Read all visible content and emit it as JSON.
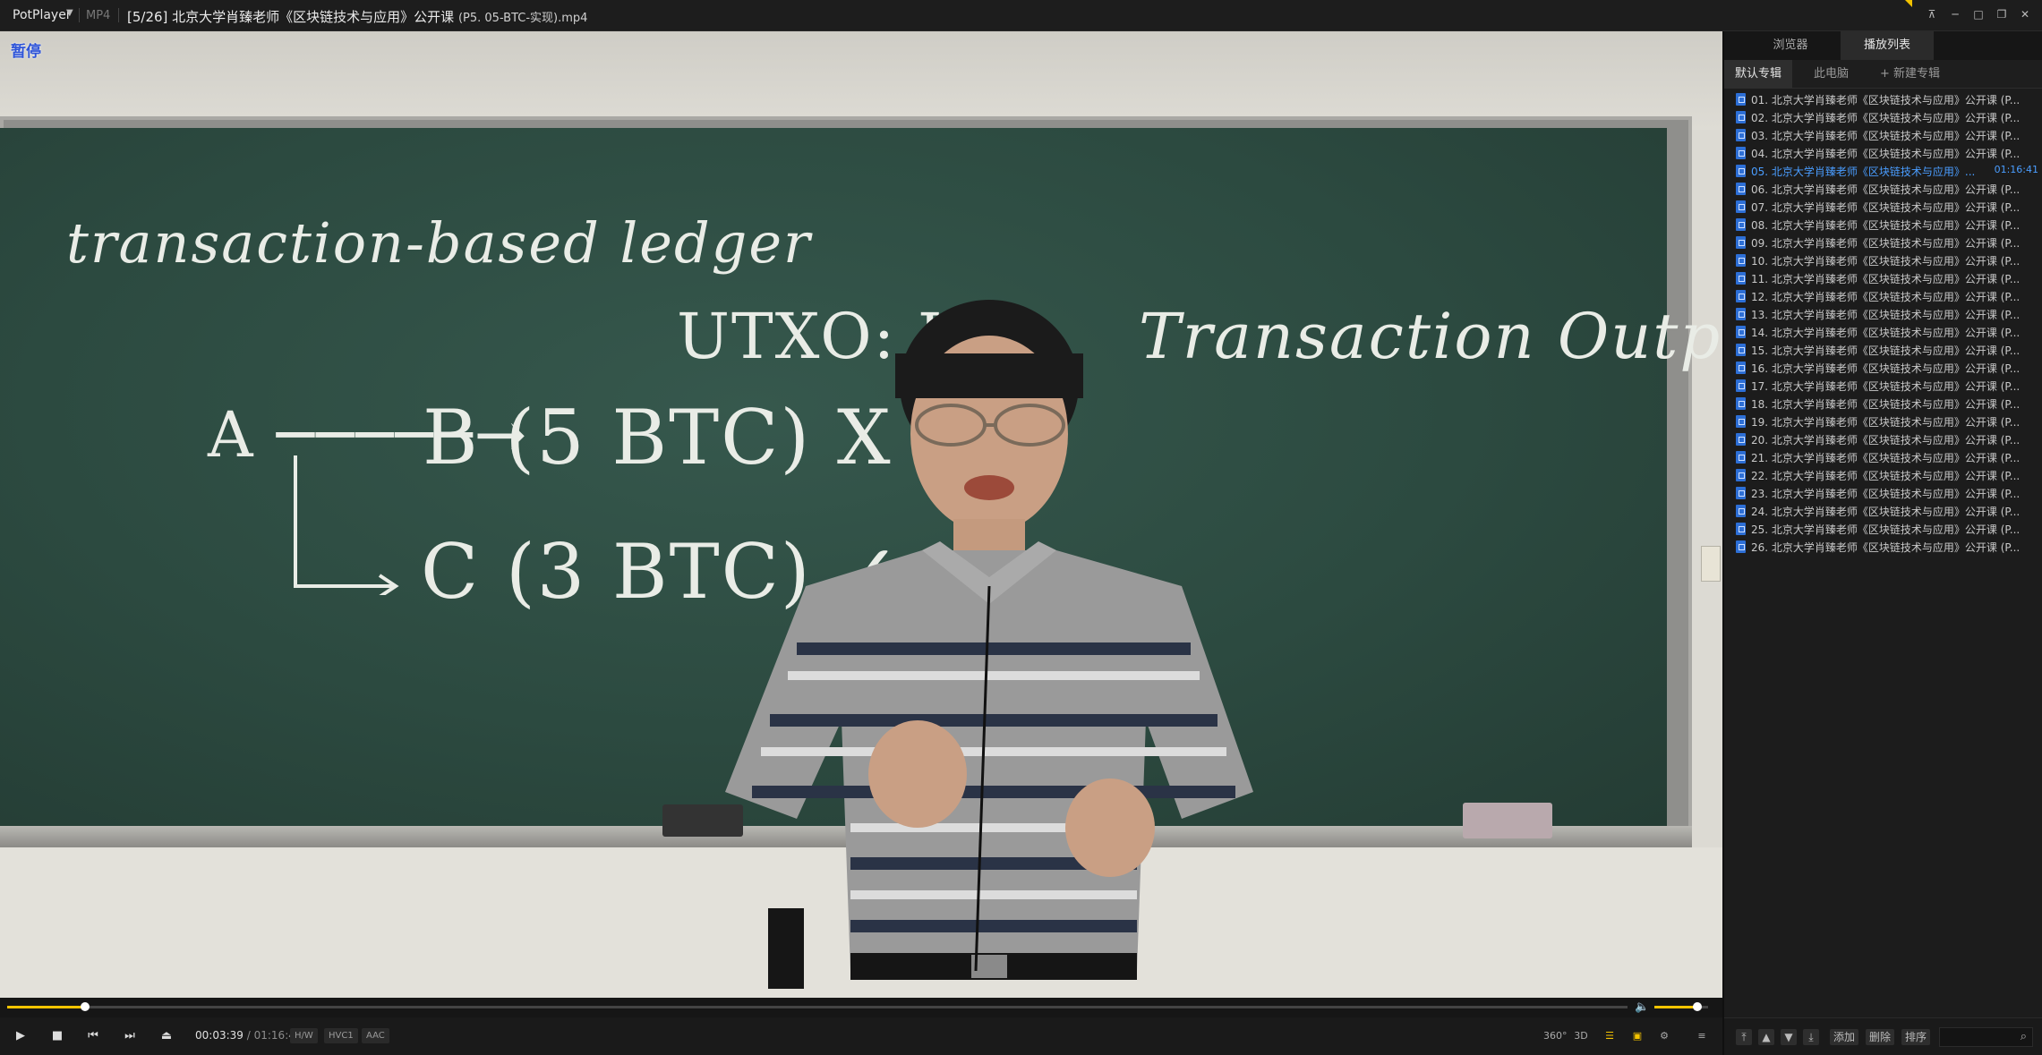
{
  "window": {
    "app_name": "PotPlayer",
    "format": "MP4",
    "title": "[5/26] 北京大学肖臻老师《区块链技术与应用》公开课",
    "title_suffix": "(P5. 05-BTC-实现).mp4",
    "controls": [
      "pin-icon",
      "minimize-icon",
      "maximize-icon",
      "restore-icon",
      "close-icon"
    ]
  },
  "video": {
    "osd_status": "暂停",
    "blackboard_lines": [
      "transaction-based ledger",
      "UTXO: U",
      "Transaction Output",
      "A ─────→",
      "B (5 BTC) X",
      "C (3 BTC) ✓"
    ]
  },
  "playback": {
    "current_time": "00:03:39",
    "total_time": "01:16:41",
    "separator": "/",
    "progress": 0.048,
    "volume": 0.8,
    "badges": [
      "H/W",
      "HVC1",
      "AAC"
    ],
    "right_controls": [
      "360°",
      "3D"
    ]
  },
  "panel": {
    "tabs": [
      "浏览器",
      "播放列表"
    ],
    "active_tab": "播放列表",
    "albums": [
      "默认专辑",
      "此电脑",
      "+ 新建专辑"
    ],
    "active_album": "默认专辑",
    "items": [
      {
        "name": "01. 北京大学肖臻老师《区块链技术与应用》公开课 (P..."
      },
      {
        "name": "02. 北京大学肖臻老师《区块链技术与应用》公开课 (P..."
      },
      {
        "name": "03. 北京大学肖臻老师《区块链技术与应用》公开课 (P..."
      },
      {
        "name": "04. 北京大学肖臻老师《区块链技术与应用》公开课 (P..."
      },
      {
        "name": "05. 北京大学肖臻老师《区块链技术与应用》...",
        "duration": "01:16:41",
        "current": true
      },
      {
        "name": "06. 北京大学肖臻老师《区块链技术与应用》公开课 (P..."
      },
      {
        "name": "07. 北京大学肖臻老师《区块链技术与应用》公开课 (P..."
      },
      {
        "name": "08. 北京大学肖臻老师《区块链技术与应用》公开课 (P..."
      },
      {
        "name": "09. 北京大学肖臻老师《区块链技术与应用》公开课 (P..."
      },
      {
        "name": "10. 北京大学肖臻老师《区块链技术与应用》公开课 (P..."
      },
      {
        "name": "11. 北京大学肖臻老师《区块链技术与应用》公开课 (P..."
      },
      {
        "name": "12. 北京大学肖臻老师《区块链技术与应用》公开课 (P..."
      },
      {
        "name": "13. 北京大学肖臻老师《区块链技术与应用》公开课 (P..."
      },
      {
        "name": "14. 北京大学肖臻老师《区块链技术与应用》公开课 (P..."
      },
      {
        "name": "15. 北京大学肖臻老师《区块链技术与应用》公开课 (P..."
      },
      {
        "name": "16. 北京大学肖臻老师《区块链技术与应用》公开课 (P..."
      },
      {
        "name": "17. 北京大学肖臻老师《区块链技术与应用》公开课 (P..."
      },
      {
        "name": "18. 北京大学肖臻老师《区块链技术与应用》公开课 (P..."
      },
      {
        "name": "19. 北京大学肖臻老师《区块链技术与应用》公开课 (P..."
      },
      {
        "name": "20. 北京大学肖臻老师《区块链技术与应用》公开课 (P..."
      },
      {
        "name": "21. 北京大学肖臻老师《区块链技术与应用》公开课 (P..."
      },
      {
        "name": "22. 北京大学肖臻老师《区块链技术与应用》公开课 (P..."
      },
      {
        "name": "23. 北京大学肖臻老师《区块链技术与应用》公开课 (P..."
      },
      {
        "name": "24. 北京大学肖臻老师《区块链技术与应用》公开课 (P..."
      },
      {
        "name": "25. 北京大学肖臻老师《区块链技术与应用》公开课 (P..."
      },
      {
        "name": "26. 北京大学肖臻老师《区块链技术与应用》公开课 (P..."
      }
    ],
    "bottom_buttons": [
      "添加",
      "删除",
      "排序"
    ]
  },
  "colors": {
    "accent": "#f5c400",
    "current_item": "#4a9dff",
    "board_green": "#2c4a40"
  }
}
